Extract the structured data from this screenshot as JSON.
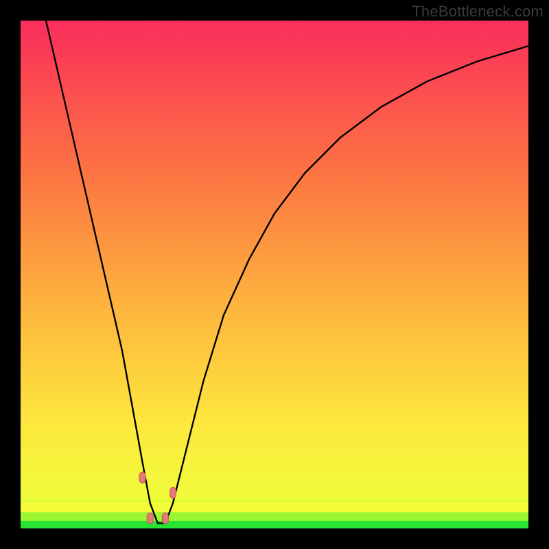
{
  "watermark": "TheBottleneck.com",
  "chart_data": {
    "type": "line",
    "title": "",
    "xlabel": "",
    "ylabel": "",
    "xlim": [
      0,
      100
    ],
    "ylim": [
      0,
      100
    ],
    "grid": false,
    "legend": false,
    "series": [
      {
        "name": "bottleneck-curve",
        "x": [
          5,
          8,
          11,
          14,
          17,
          20,
          22,
          24,
          25.5,
          27,
          28.5,
          30,
          33,
          36,
          40,
          45,
          50,
          56,
          63,
          71,
          80,
          90,
          100
        ],
        "y": [
          100,
          87,
          74,
          61,
          48,
          35,
          24,
          13,
          5,
          1,
          1,
          5,
          17,
          29,
          42,
          53,
          62,
          70,
          77,
          83,
          88,
          92,
          95
        ]
      }
    ],
    "markers": [
      {
        "name": "marker-left",
        "x": 24.0,
        "y": 10.0
      },
      {
        "name": "marker-valley-left",
        "x": 25.5,
        "y": 2.0
      },
      {
        "name": "marker-valley-right",
        "x": 28.5,
        "y": 2.0
      },
      {
        "name": "marker-right",
        "x": 30.0,
        "y": 7.0
      }
    ],
    "bands": [
      {
        "name": "green-band",
        "y0": 0.0,
        "y1": 1.5,
        "color": "#27e433"
      },
      {
        "name": "lime-band",
        "y0": 1.5,
        "y1": 3.2,
        "color": "#9bf531"
      },
      {
        "name": "yellow-band",
        "y0": 3.2,
        "y1": 5.2,
        "color": "#f4fc3a"
      }
    ],
    "gradient_stops": [
      {
        "offset": 0.0,
        "color": "#27e433"
      },
      {
        "offset": 0.02,
        "color": "#6cee2f"
      },
      {
        "offset": 0.04,
        "color": "#b9f733"
      },
      {
        "offset": 0.06,
        "color": "#f0fb3b"
      },
      {
        "offset": 0.2,
        "color": "#fde93e"
      },
      {
        "offset": 0.45,
        "color": "#fdb13e"
      },
      {
        "offset": 0.7,
        "color": "#fc7443"
      },
      {
        "offset": 0.88,
        "color": "#fb4a51"
      },
      {
        "offset": 1.0,
        "color": "#fa2d5c"
      }
    ],
    "colors": {
      "curve": "#000000",
      "marker_fill": "#e47a78",
      "marker_stroke": "#c65652",
      "background_frame": "#000000"
    }
  }
}
